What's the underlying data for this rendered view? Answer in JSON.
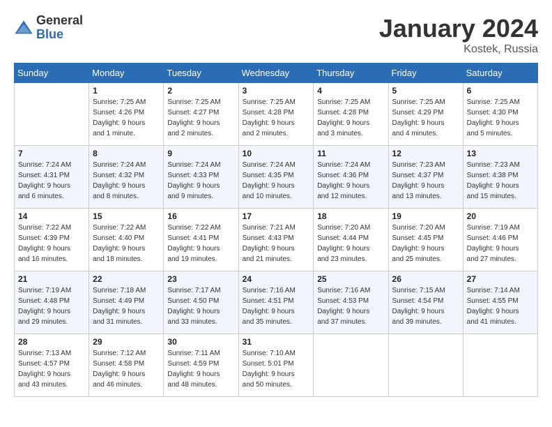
{
  "header": {
    "logo_general": "General",
    "logo_blue": "Blue",
    "month": "January 2024",
    "location": "Kostek, Russia"
  },
  "days_of_week": [
    "Sunday",
    "Monday",
    "Tuesday",
    "Wednesday",
    "Thursday",
    "Friday",
    "Saturday"
  ],
  "weeks": [
    [
      {
        "day": "",
        "info": ""
      },
      {
        "day": "1",
        "info": "Sunrise: 7:25 AM\nSunset: 4:26 PM\nDaylight: 9 hours\nand 1 minute."
      },
      {
        "day": "2",
        "info": "Sunrise: 7:25 AM\nSunset: 4:27 PM\nDaylight: 9 hours\nand 2 minutes."
      },
      {
        "day": "3",
        "info": "Sunrise: 7:25 AM\nSunset: 4:28 PM\nDaylight: 9 hours\nand 2 minutes."
      },
      {
        "day": "4",
        "info": "Sunrise: 7:25 AM\nSunset: 4:28 PM\nDaylight: 9 hours\nand 3 minutes."
      },
      {
        "day": "5",
        "info": "Sunrise: 7:25 AM\nSunset: 4:29 PM\nDaylight: 9 hours\nand 4 minutes."
      },
      {
        "day": "6",
        "info": "Sunrise: 7:25 AM\nSunset: 4:30 PM\nDaylight: 9 hours\nand 5 minutes."
      }
    ],
    [
      {
        "day": "7",
        "info": "Sunrise: 7:24 AM\nSunset: 4:31 PM\nDaylight: 9 hours\nand 6 minutes."
      },
      {
        "day": "8",
        "info": "Sunrise: 7:24 AM\nSunset: 4:32 PM\nDaylight: 9 hours\nand 8 minutes."
      },
      {
        "day": "9",
        "info": "Sunrise: 7:24 AM\nSunset: 4:33 PM\nDaylight: 9 hours\nand 9 minutes."
      },
      {
        "day": "10",
        "info": "Sunrise: 7:24 AM\nSunset: 4:35 PM\nDaylight: 9 hours\nand 10 minutes."
      },
      {
        "day": "11",
        "info": "Sunrise: 7:24 AM\nSunset: 4:36 PM\nDaylight: 9 hours\nand 12 minutes."
      },
      {
        "day": "12",
        "info": "Sunrise: 7:23 AM\nSunset: 4:37 PM\nDaylight: 9 hours\nand 13 minutes."
      },
      {
        "day": "13",
        "info": "Sunrise: 7:23 AM\nSunset: 4:38 PM\nDaylight: 9 hours\nand 15 minutes."
      }
    ],
    [
      {
        "day": "14",
        "info": "Sunrise: 7:22 AM\nSunset: 4:39 PM\nDaylight: 9 hours\nand 16 minutes."
      },
      {
        "day": "15",
        "info": "Sunrise: 7:22 AM\nSunset: 4:40 PM\nDaylight: 9 hours\nand 18 minutes."
      },
      {
        "day": "16",
        "info": "Sunrise: 7:22 AM\nSunset: 4:41 PM\nDaylight: 9 hours\nand 19 minutes."
      },
      {
        "day": "17",
        "info": "Sunrise: 7:21 AM\nSunset: 4:43 PM\nDaylight: 9 hours\nand 21 minutes."
      },
      {
        "day": "18",
        "info": "Sunrise: 7:20 AM\nSunset: 4:44 PM\nDaylight: 9 hours\nand 23 minutes."
      },
      {
        "day": "19",
        "info": "Sunrise: 7:20 AM\nSunset: 4:45 PM\nDaylight: 9 hours\nand 25 minutes."
      },
      {
        "day": "20",
        "info": "Sunrise: 7:19 AM\nSunset: 4:46 PM\nDaylight: 9 hours\nand 27 minutes."
      }
    ],
    [
      {
        "day": "21",
        "info": "Sunrise: 7:19 AM\nSunset: 4:48 PM\nDaylight: 9 hours\nand 29 minutes."
      },
      {
        "day": "22",
        "info": "Sunrise: 7:18 AM\nSunset: 4:49 PM\nDaylight: 9 hours\nand 31 minutes."
      },
      {
        "day": "23",
        "info": "Sunrise: 7:17 AM\nSunset: 4:50 PM\nDaylight: 9 hours\nand 33 minutes."
      },
      {
        "day": "24",
        "info": "Sunrise: 7:16 AM\nSunset: 4:51 PM\nDaylight: 9 hours\nand 35 minutes."
      },
      {
        "day": "25",
        "info": "Sunrise: 7:16 AM\nSunset: 4:53 PM\nDaylight: 9 hours\nand 37 minutes."
      },
      {
        "day": "26",
        "info": "Sunrise: 7:15 AM\nSunset: 4:54 PM\nDaylight: 9 hours\nand 39 minutes."
      },
      {
        "day": "27",
        "info": "Sunrise: 7:14 AM\nSunset: 4:55 PM\nDaylight: 9 hours\nand 41 minutes."
      }
    ],
    [
      {
        "day": "28",
        "info": "Sunrise: 7:13 AM\nSunset: 4:57 PM\nDaylight: 9 hours\nand 43 minutes."
      },
      {
        "day": "29",
        "info": "Sunrise: 7:12 AM\nSunset: 4:58 PM\nDaylight: 9 hours\nand 46 minutes."
      },
      {
        "day": "30",
        "info": "Sunrise: 7:11 AM\nSunset: 4:59 PM\nDaylight: 9 hours\nand 48 minutes."
      },
      {
        "day": "31",
        "info": "Sunrise: 7:10 AM\nSunset: 5:01 PM\nDaylight: 9 hours\nand 50 minutes."
      },
      {
        "day": "",
        "info": ""
      },
      {
        "day": "",
        "info": ""
      },
      {
        "day": "",
        "info": ""
      }
    ]
  ]
}
